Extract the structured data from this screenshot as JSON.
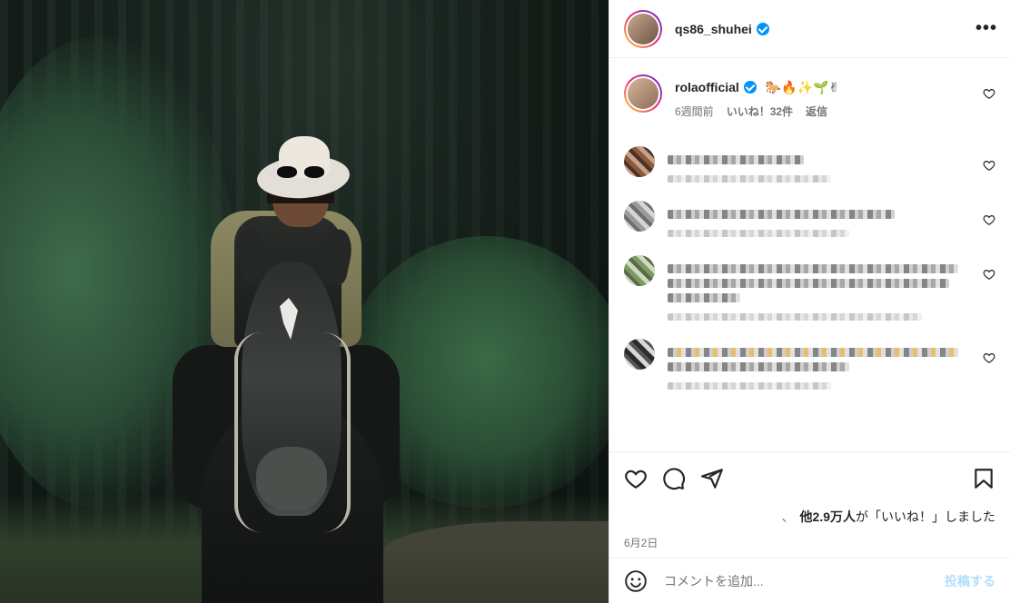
{
  "header": {
    "username": "qs86_shuhei",
    "more_icon": "more-horizontal-icon"
  },
  "caption": {
    "username": "rolaofficial",
    "text": "🐎🔥✨🌱✌",
    "time": "6週間前",
    "likes": "いいね！32件",
    "reply": "返信"
  },
  "actions": {
    "like_icon": "heart-icon",
    "comment_icon": "comment-icon",
    "share_icon": "send-icon",
    "save_icon": "bookmark-icon"
  },
  "likes_summary": {
    "prefix": "、",
    "count": "他2.9万人",
    "suffix": "が「いいね！」しました"
  },
  "post_date": "6月2日",
  "add_comment": {
    "placeholder": "コメントを追加...",
    "post_label": "投稿する"
  },
  "colors": {
    "verified": "#0095f6",
    "post_button_disabled": "#b2dffc"
  }
}
